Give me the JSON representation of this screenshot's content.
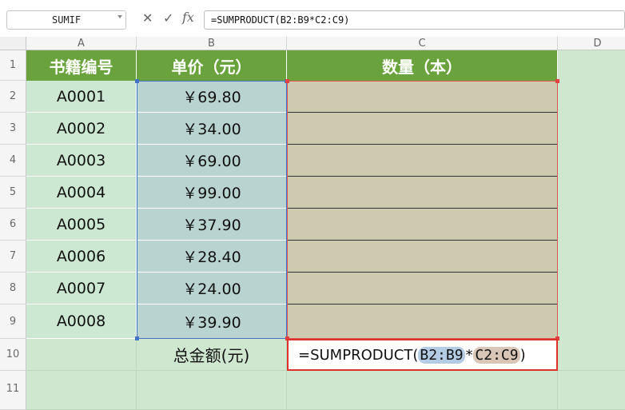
{
  "formula_bar": {
    "name_box": "SUMIF",
    "cancel_icon": "✕",
    "enter_icon": "✓",
    "fx_label": "fx",
    "formula": "=SUMPRODUCT(B2:B9*C2:C9)"
  },
  "columns": [
    "A",
    "B",
    "C",
    "D"
  ],
  "rows": [
    "1",
    "2",
    "3",
    "4",
    "5",
    "6",
    "7",
    "8",
    "9",
    "10",
    "11"
  ],
  "table": {
    "headers": [
      "书籍编号",
      "单价（元）",
      "数量（本）"
    ],
    "rows": [
      {
        "id": "A0001",
        "price": "￥69.80"
      },
      {
        "id": "A0002",
        "price": "￥34.00"
      },
      {
        "id": "A0003",
        "price": "￥69.00"
      },
      {
        "id": "A0004",
        "price": "￥99.00"
      },
      {
        "id": "A0005",
        "price": "￥37.90"
      },
      {
        "id": "A0006",
        "price": "￥28.40"
      },
      {
        "id": "A0007",
        "price": "￥24.00"
      },
      {
        "id": "A0008",
        "price": "￥39.90"
      }
    ],
    "total_label": "总金额(元)"
  },
  "edit_cell": {
    "prefix": "=SUMPRODUCT(",
    "ref1": "B2:B9",
    "op": "*",
    "ref2": "C2:C9",
    "suffix": ")"
  },
  "colors": {
    "header_green": "#6aa33e",
    "sheet_bg": "#cfe6cf",
    "ref_b_highlight": "#b3cce3",
    "ref_c_highlight": "#d9c6b6",
    "edit_border": "#e0302a"
  }
}
